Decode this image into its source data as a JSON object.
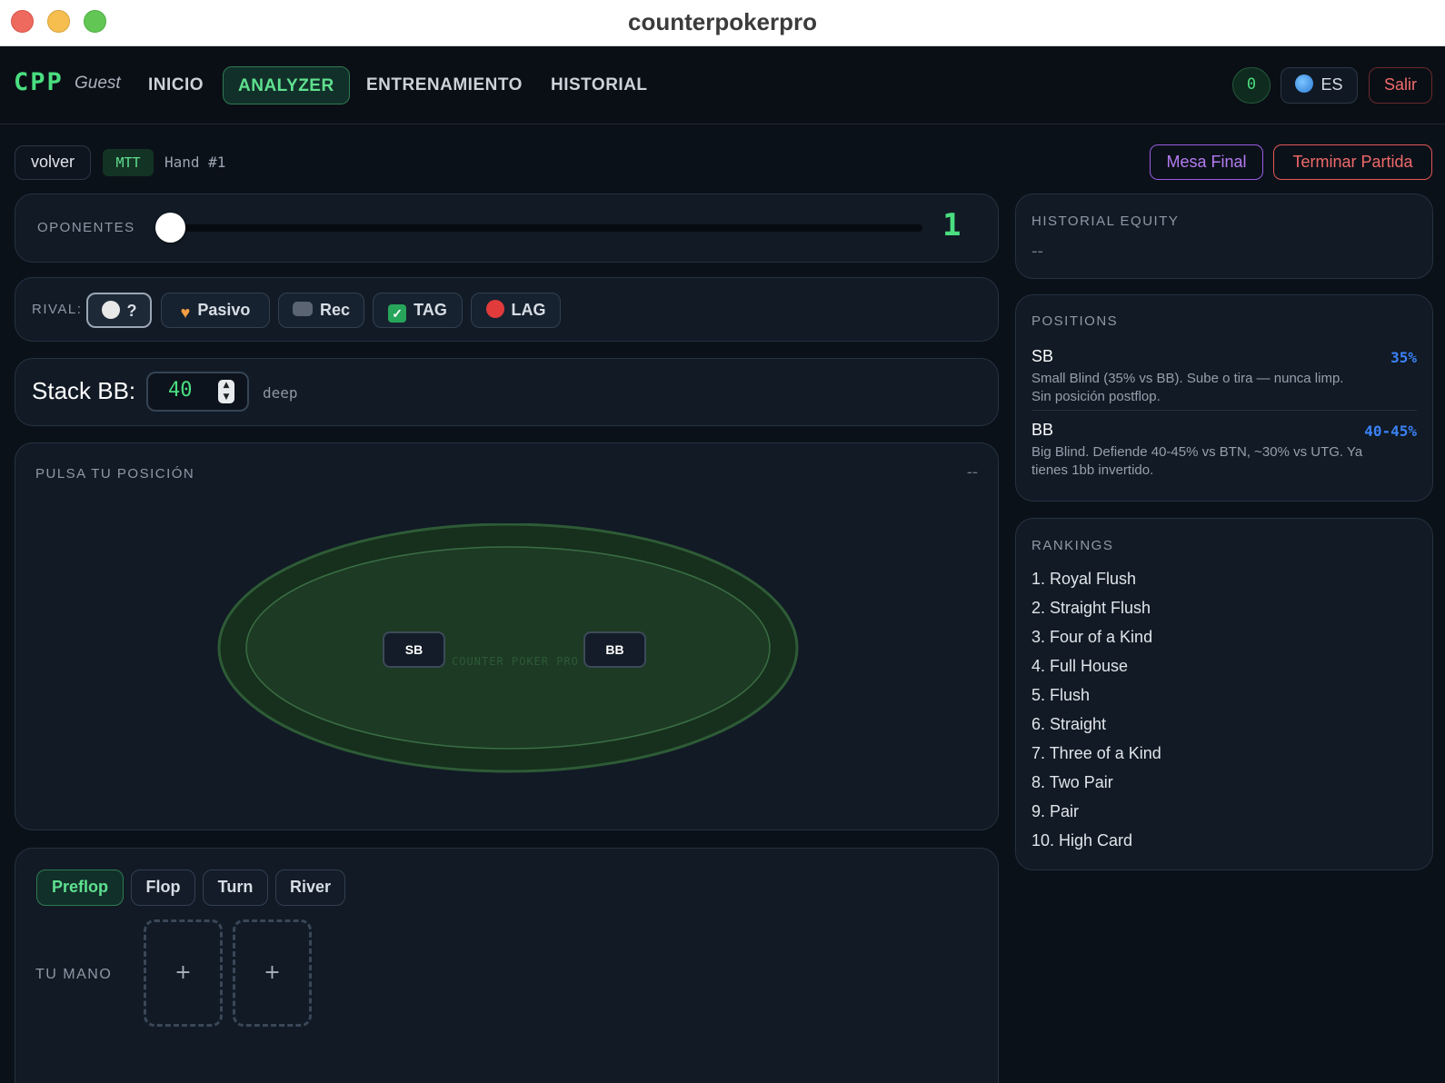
{
  "window": {
    "title": "counterpokerpro"
  },
  "nav": {
    "logo": "CPP",
    "user": "Guest",
    "links": {
      "inicio": "INICIO",
      "analyzer": "ANALYZER",
      "entrenamiento": "ENTRENAMIENTO",
      "historial": "HISTORIAL"
    },
    "active": "ANALYZER",
    "counter": "0",
    "lang": "ES",
    "logout": "Salir"
  },
  "subheader": {
    "back": "volver",
    "mode": "MTT",
    "hand": "Hand #1",
    "final_table": "Mesa Final",
    "end_game": "Terminar Partida"
  },
  "opponents": {
    "label": "OPONENTES",
    "value": "1",
    "slider_fraction": 0.0
  },
  "rival": {
    "label": "RIVAL:",
    "options": [
      {
        "label": "?",
        "icon": "white-circle-icon",
        "selected": true
      },
      {
        "label": "Pasivo",
        "icon": "orange-heart-icon"
      },
      {
        "label": "Rec",
        "icon": "gamepad-icon"
      },
      {
        "label": "TAG",
        "icon": "check-mark-icon"
      },
      {
        "label": "LAG",
        "icon": "red-circle-icon"
      }
    ]
  },
  "stack": {
    "label": "Stack BB:",
    "value": "40",
    "depth": "deep"
  },
  "table": {
    "label": "PULSA TU POSICIÓN",
    "value": "--",
    "felt_text": "COUNTER POKER PRO",
    "seats": [
      "SB",
      "BB"
    ],
    "felt_color": "#1d3a24"
  },
  "streets": {
    "tabs": [
      "Preflop",
      "Flop",
      "Turn",
      "River"
    ],
    "active": "Preflop",
    "hand_label": "TU MANO",
    "card_slot_symbol": "+"
  },
  "equity": {
    "label": "HISTORIAL EQUITY",
    "value": "--"
  },
  "positions": {
    "label": "POSITIONS",
    "items": [
      {
        "name": "SB",
        "pct": "35%",
        "desc": "Small Blind (35% vs BB). Sube o tira — nunca limp. Sin posición postflop."
      },
      {
        "name": "BB",
        "pct": "40-45%",
        "desc": "Big Blind. Defiende 40-45% vs BTN, ~30% vs UTG. Ya tienes 1bb invertido."
      }
    ]
  },
  "rankings": {
    "label": "RANKINGS",
    "items": [
      "1. Royal Flush",
      "2. Straight Flush",
      "3. Four of a Kind",
      "4. Full House",
      "5. Flush",
      "6. Straight",
      "7. Three of a Kind",
      "8. Two Pair",
      "9. Pair",
      "10. High Card"
    ]
  },
  "colors": {
    "accent": "#4ade80",
    "purple": "#9b5de5",
    "danger": "#e05757",
    "blue": "#3b82f6"
  }
}
